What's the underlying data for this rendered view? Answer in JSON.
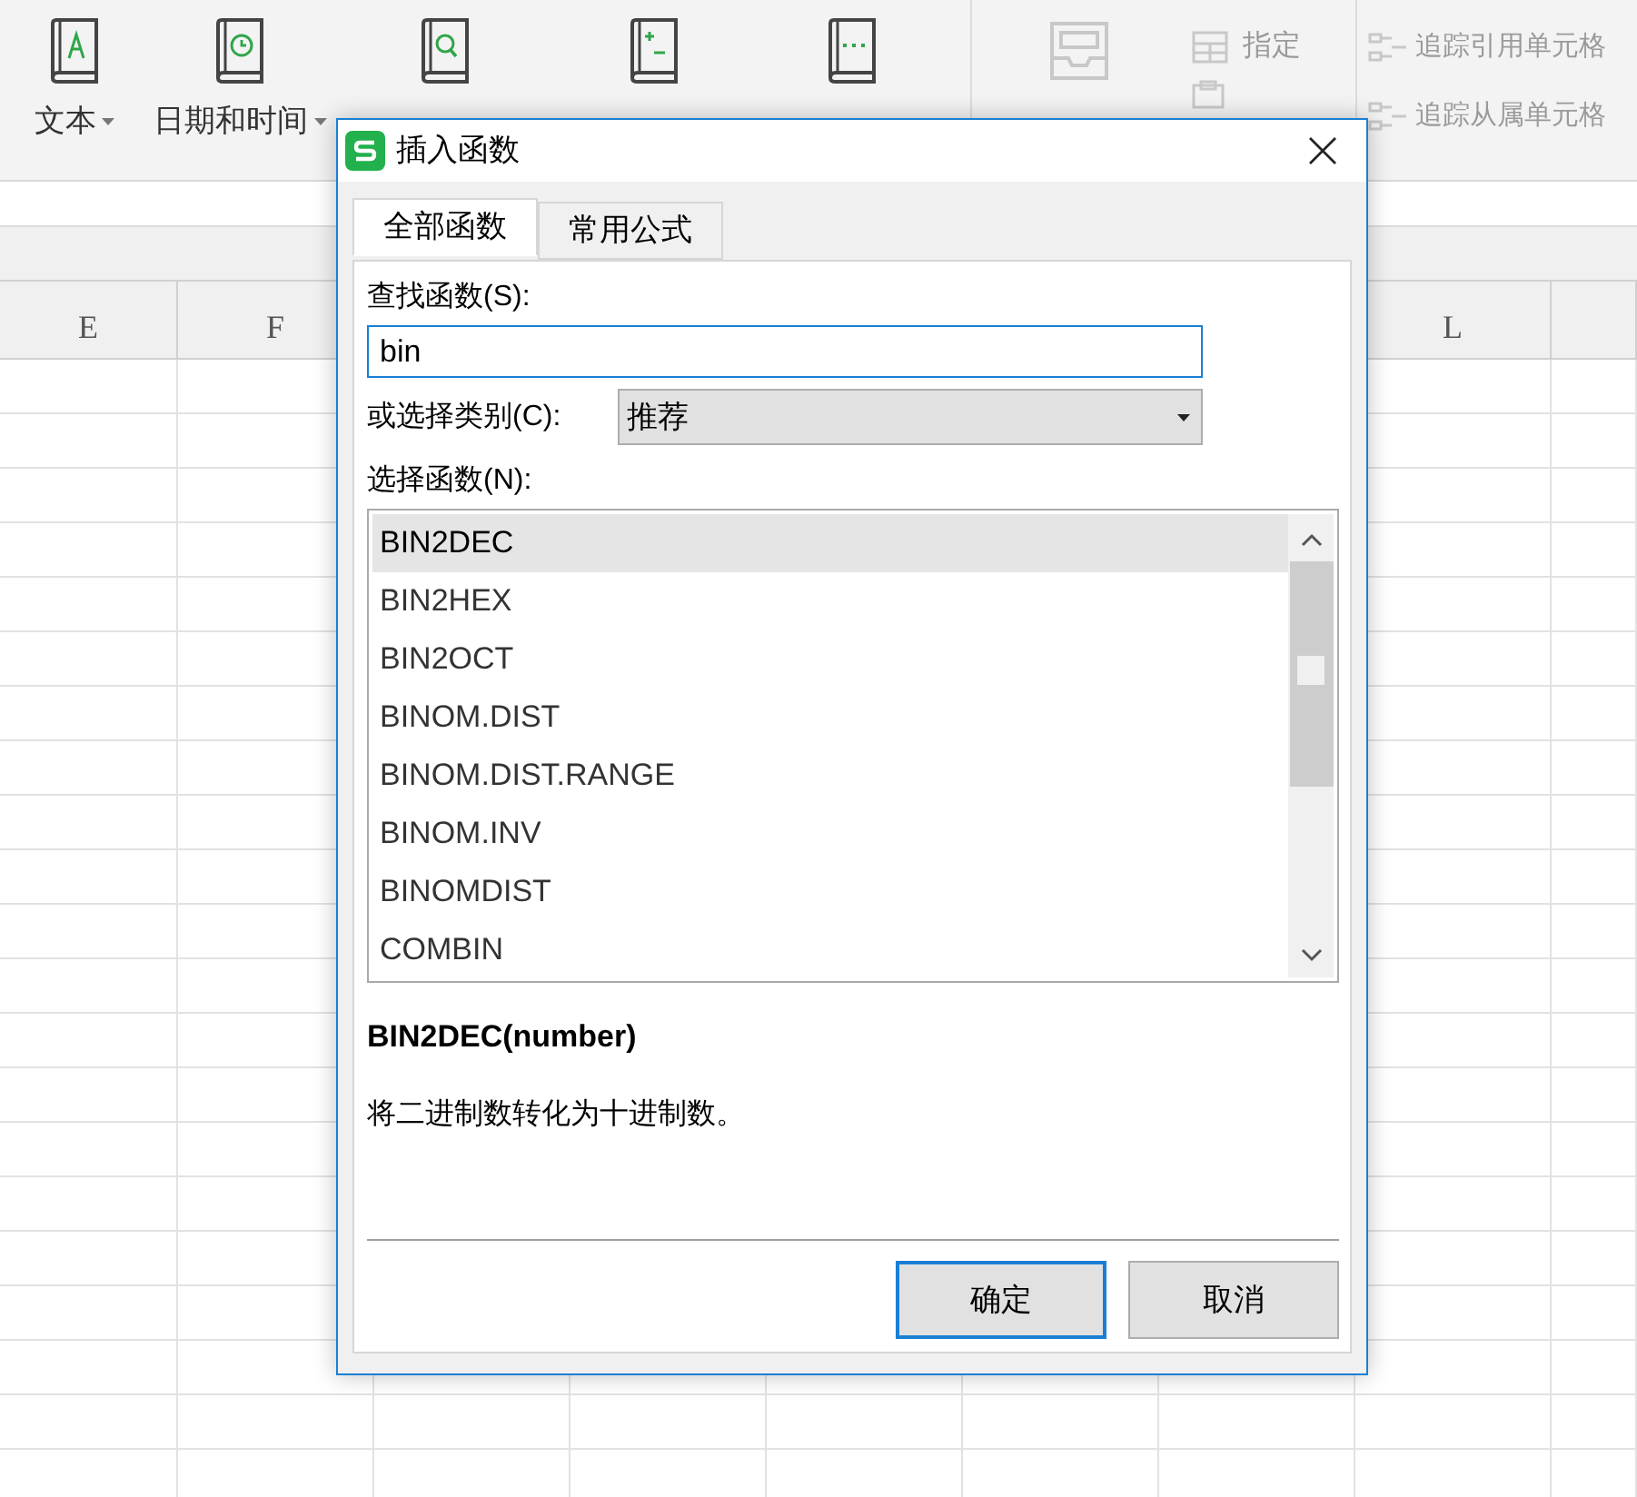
{
  "toolbar": {
    "large_buttons": [
      {
        "label": "文本",
        "dropdown": true,
        "disabled": false
      },
      {
        "label": "日期和时间",
        "dropdown": true,
        "disabled": false
      },
      {
        "disabled": false
      },
      {
        "disabled": false
      },
      {
        "disabled": false
      },
      {
        "disabled": true
      }
    ],
    "small_buttons": [
      {
        "label": "指定",
        "disabled": true
      }
    ],
    "trace_buttons": [
      {
        "label": "追踪引用单元格",
        "disabled": true
      },
      {
        "label": "追踪从属单元格",
        "disabled": true
      }
    ]
  },
  "sheet": {
    "column_headers": [
      {
        "label": "E"
      },
      {
        "label": "F"
      },
      {
        "label": "L"
      }
    ]
  },
  "dialog": {
    "title": "插入函数",
    "tabs": [
      {
        "label": "全部函数",
        "selected": true
      },
      {
        "label": "常用公式",
        "selected": false
      }
    ],
    "search_label": "查找函数(S):",
    "search_value": "bin",
    "category_label": "或选择类别(C):",
    "category_value": "推荐",
    "list_label": "选择函数(N):",
    "functions": [
      {
        "name": "BIN2DEC",
        "selected": true
      },
      {
        "name": "BIN2HEX",
        "selected": false
      },
      {
        "name": "BIN2OCT",
        "selected": false
      },
      {
        "name": "BINOM.DIST",
        "selected": false
      },
      {
        "name": "BINOM.DIST.RANGE",
        "selected": false
      },
      {
        "name": "BINOM.INV",
        "selected": false
      },
      {
        "name": "BINOMDIST",
        "selected": false
      },
      {
        "name": "COMBIN",
        "selected": false
      }
    ],
    "signature": "BIN2DEC(number)",
    "description": "将二进制数转化为十进制数。",
    "buttons": [
      {
        "label": "确定",
        "default": true
      },
      {
        "label": "取消",
        "default": false
      }
    ]
  }
}
